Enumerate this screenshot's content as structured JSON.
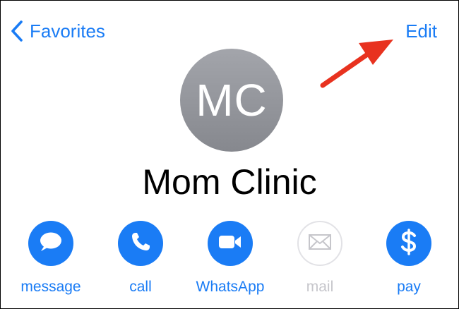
{
  "nav": {
    "back_label": "Favorites",
    "edit_label": "Edit"
  },
  "contact": {
    "initials": "MC",
    "name": "Mom Clinic"
  },
  "actions": [
    {
      "label": "message",
      "icon": "message-bubble-icon",
      "enabled": true
    },
    {
      "label": "call",
      "icon": "phone-icon",
      "enabled": true
    },
    {
      "label": "WhatsApp",
      "icon": "video-camera-icon",
      "enabled": true
    },
    {
      "label": "mail",
      "icon": "envelope-icon",
      "enabled": false
    },
    {
      "label": "pay",
      "icon": "dollar-icon",
      "enabled": true
    }
  ],
  "colors": {
    "accent": "#1a7cf5",
    "disabled": "#c6c6cb",
    "avatar": "#95979c",
    "annotation_arrow": "#e8321f"
  }
}
